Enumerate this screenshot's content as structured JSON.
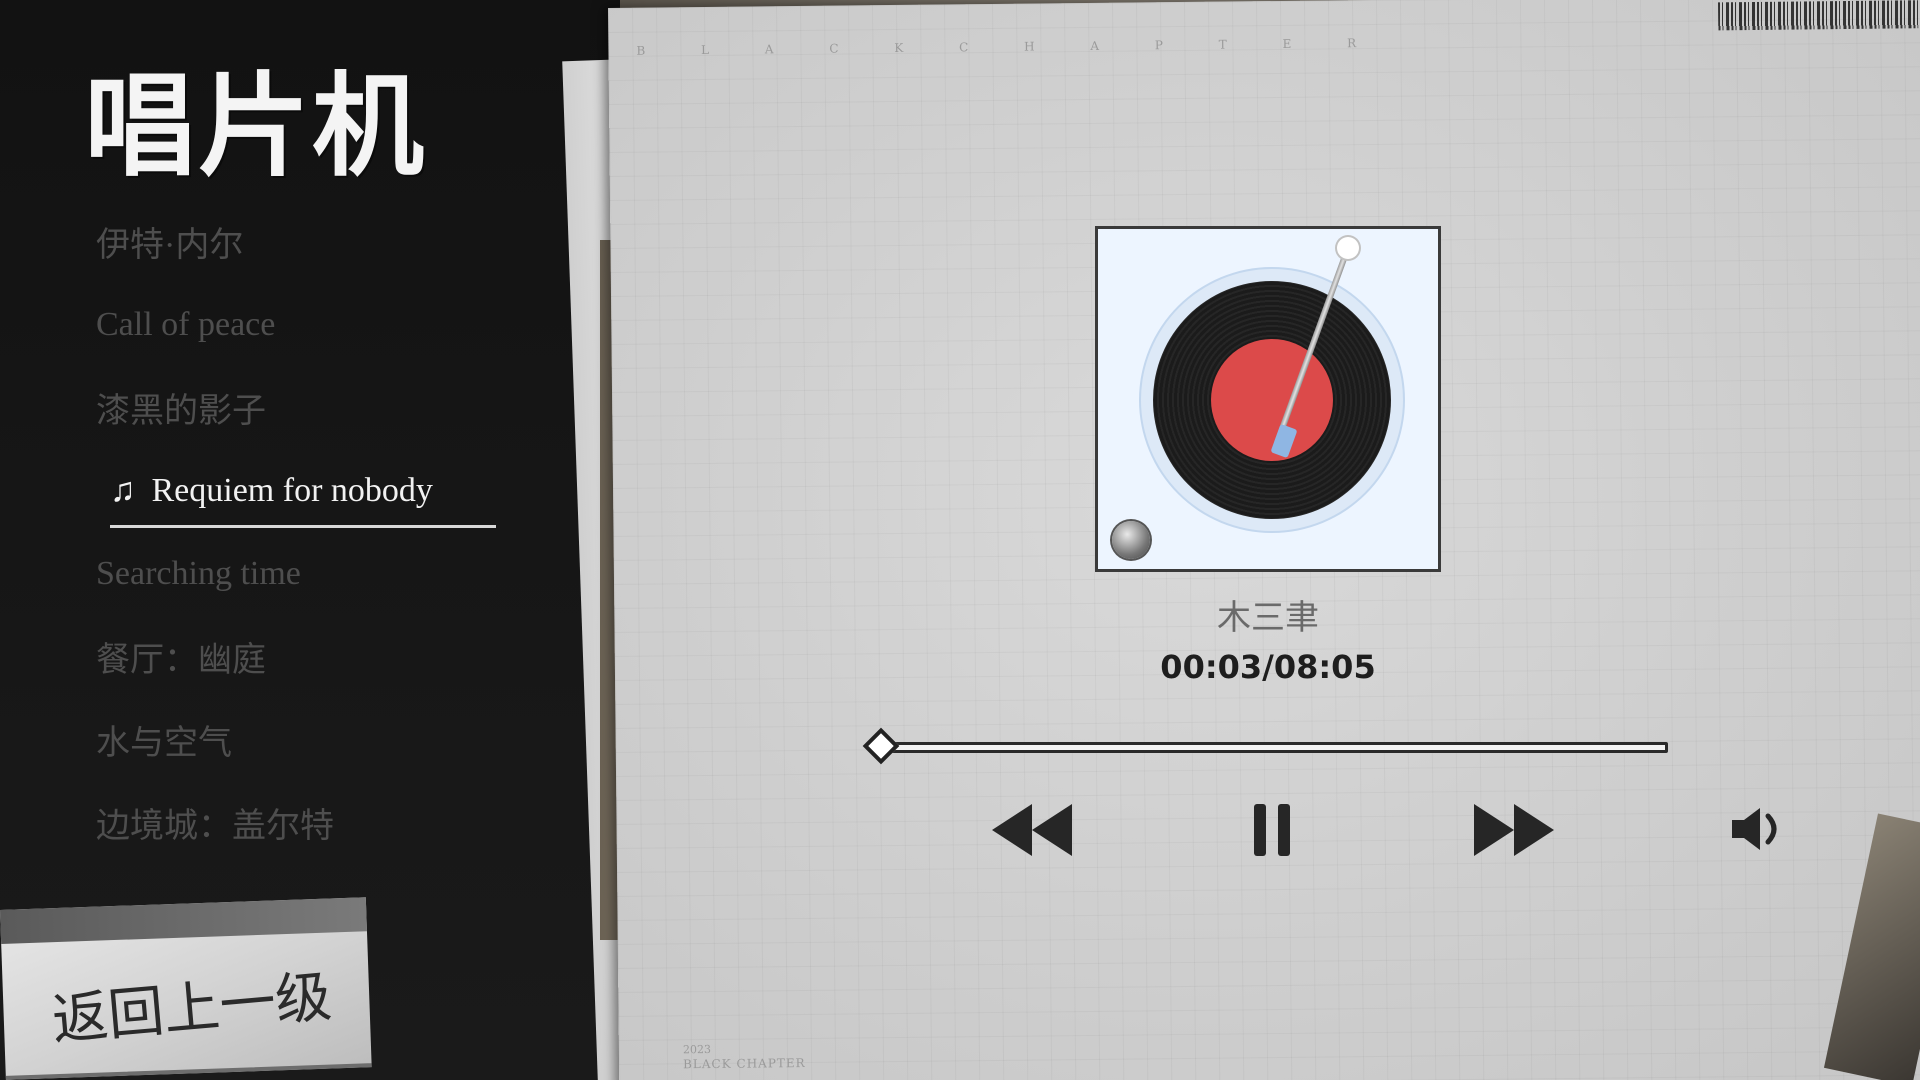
{
  "app": {
    "title": "唱片机"
  },
  "playlist": {
    "tracks": [
      {
        "label": "伊特·内尔"
      },
      {
        "label": "Call of peace"
      },
      {
        "label": "漆黑的影子"
      },
      {
        "label": "Requiem for nobody",
        "active": true
      },
      {
        "label": "Searching time"
      },
      {
        "label": "餐厅：幽庭"
      },
      {
        "label": "水与空气"
      },
      {
        "label": "边境城：盖尔特"
      }
    ],
    "active_icon": "music-note-icon"
  },
  "back": {
    "label": "返回上一级"
  },
  "paper": {
    "header": "B L A C K   C H A P T E R",
    "footer_year": "2023",
    "footer_brand": "BLACK CHAPTER"
  },
  "now_playing": {
    "artist": "木三聿",
    "time": "00:03/08:05",
    "progress_fraction": 0.006
  },
  "controls": {
    "previous_icon": "rewind-icon",
    "pause_icon": "pause-icon",
    "next_icon": "fast-forward-icon",
    "volume_icon": "volume-icon"
  },
  "colors": {
    "active_text": "#f2f2f2",
    "inactive_text": "#4e4e4e",
    "vinyl_label": "#dc4a4a",
    "album_bg": "#edf5ff"
  }
}
